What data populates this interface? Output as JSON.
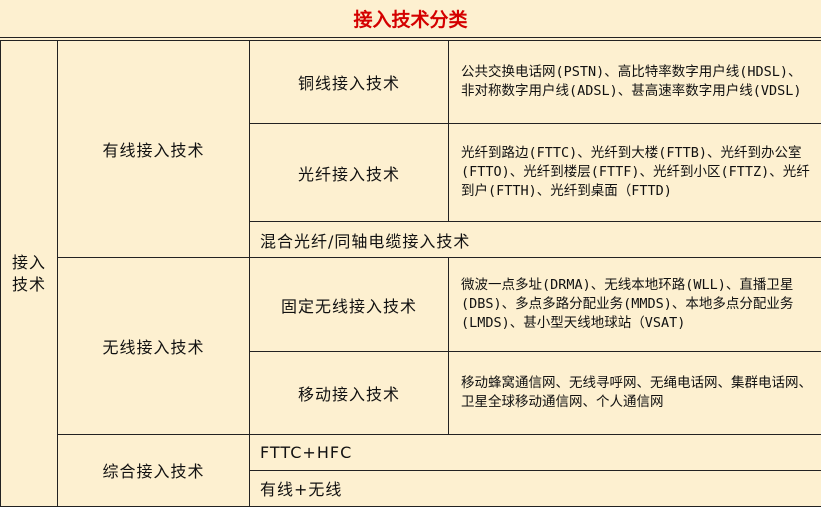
{
  "title": "接入技术分类",
  "category": "接入技术",
  "wired": {
    "label": "有线接入技术",
    "copper": {
      "label": "铜线接入技术",
      "desc": "公共交换电话网(PSTN)、高比特率数字用户线(HDSL)、非对称数字用户线(ADSL)、甚高速率数字用户线(VDSL)"
    },
    "fiber": {
      "label": "光纤接入技术",
      "desc": "光纤到路边(FTTC)、光纤到大楼(FTTB)、光纤到办公室(FTTO)、光纤到楼层(FTTF)、光纤到小区(FTTZ)、光纤到户(FTTH)、光纤到桌面（FTTD)"
    },
    "hybrid": {
      "label": "混合光纤/同轴电缆接入技术"
    }
  },
  "wireless": {
    "label": "无线接入技术",
    "fixed": {
      "label": "固定无线接入技术",
      "desc": "微波一点多址(DRMA)、无线本地环路(WLL)、直播卫星(DBS)、多点多路分配业务(MMDS)、本地多点分配业务(LMDS)、甚小型天线地球站（VSAT)"
    },
    "mobile": {
      "label": "移动接入技术",
      "desc": "移动蜂窝通信网、无线寻呼网、无绳电话网、集群电话网、卫星全球移动通信网、个人通信网"
    }
  },
  "integrated": {
    "label": "综合接入技术",
    "items": [
      "FTTC+HFC",
      "有线+无线"
    ]
  }
}
